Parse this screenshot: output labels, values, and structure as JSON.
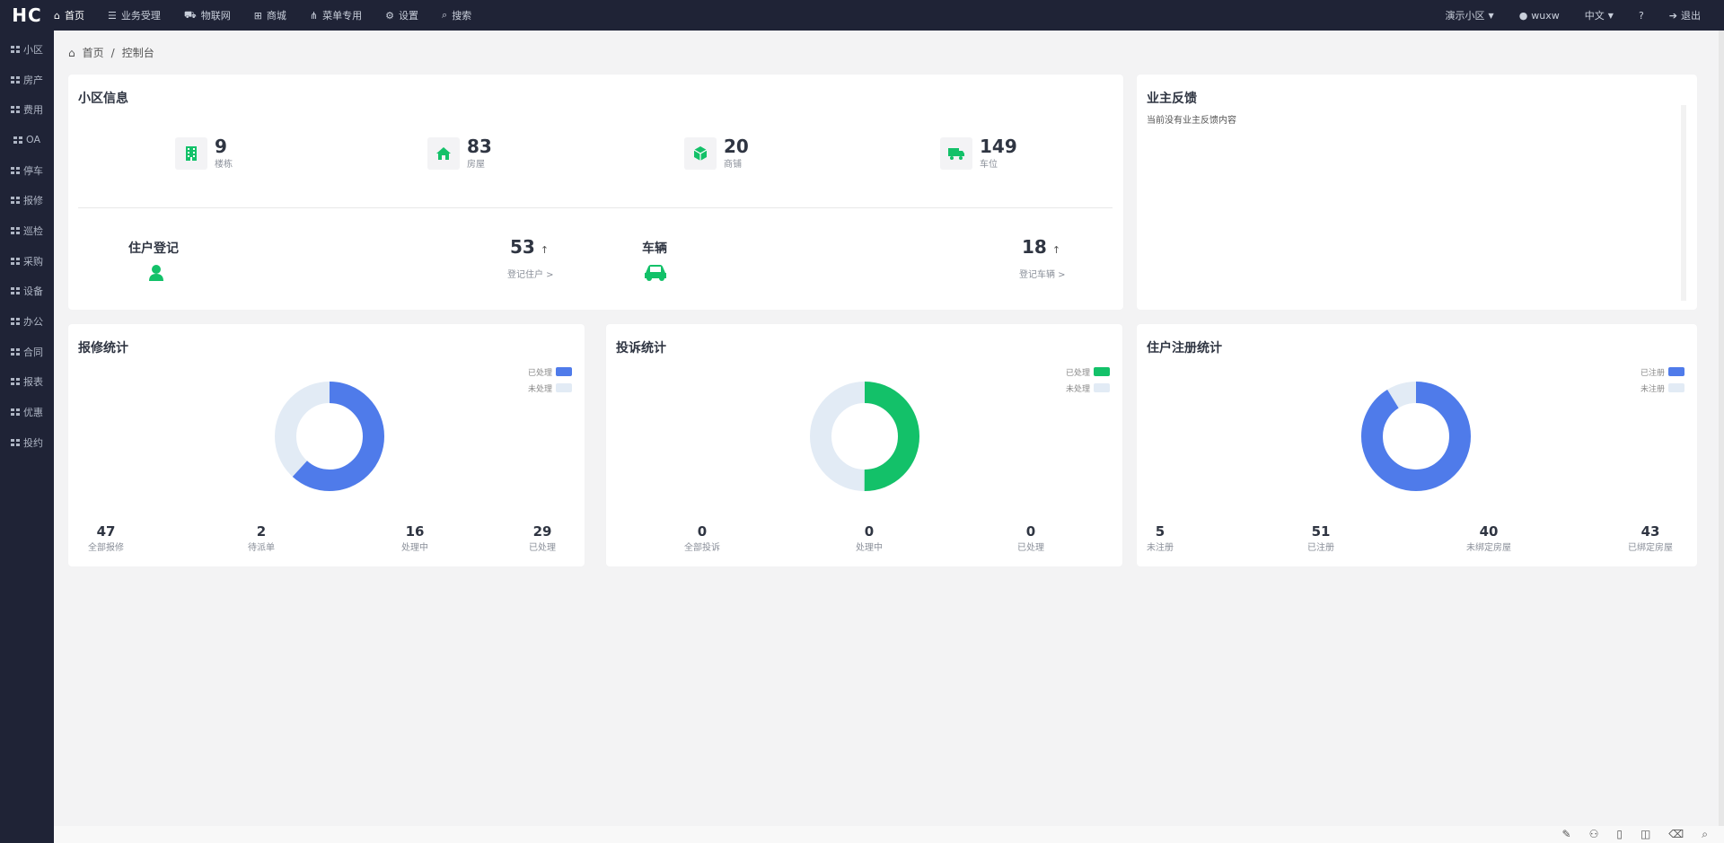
{
  "brand": "HC",
  "topnav": [
    {
      "icon": "home-icon",
      "glyph": "⌂",
      "label": "首页"
    },
    {
      "icon": "document-icon",
      "glyph": "☰",
      "label": "业务受理"
    },
    {
      "icon": "car-icon",
      "glyph": "⛟",
      "label": "物联网"
    },
    {
      "icon": "cart-icon",
      "glyph": "⊞",
      "label": "商城"
    },
    {
      "icon": "sitemap-icon",
      "glyph": "⋔",
      "label": "菜单专用"
    },
    {
      "icon": "gear-icon",
      "glyph": "⚙",
      "label": "设置"
    },
    {
      "icon": "search-icon",
      "glyph": "⌕",
      "label": "搜索"
    }
  ],
  "topright": {
    "community": "演示小区",
    "user": "wuxw",
    "language": "中文",
    "help_glyph": "?",
    "logout": "退出"
  },
  "sidebar": [
    {
      "label": "小区"
    },
    {
      "label": "房产"
    },
    {
      "label": "费用"
    },
    {
      "label": "OA"
    },
    {
      "label": "停车"
    },
    {
      "label": "报修"
    },
    {
      "label": "巡检"
    },
    {
      "label": "采购"
    },
    {
      "label": "设备"
    },
    {
      "label": "办公"
    },
    {
      "label": "合同"
    },
    {
      "label": "报表"
    },
    {
      "label": "优惠"
    },
    {
      "label": "投约"
    }
  ],
  "breadcrumb": {
    "home": "首页",
    "sep": "/",
    "current": "控制台"
  },
  "community_info": {
    "title": "小区信息",
    "stats": [
      {
        "value": "9",
        "label": "楼栋",
        "icon": "building-icon"
      },
      {
        "value": "83",
        "label": "房屋",
        "icon": "house-icon"
      },
      {
        "value": "20",
        "label": "商铺",
        "icon": "cube-icon"
      },
      {
        "value": "149",
        "label": "车位",
        "icon": "truck-icon"
      }
    ],
    "resident": {
      "title": "住户登记",
      "value": "53",
      "link": "登记住户 >"
    },
    "vehicle": {
      "title": "车辆",
      "value": "18",
      "link": "登记车辆 >"
    }
  },
  "feedback": {
    "title": "业主反馈",
    "content": "当前没有业主反馈内容"
  },
  "repair": {
    "title": "报修统计",
    "legend": [
      "已处理",
      "未处理"
    ],
    "colors": [
      "#4f7bea",
      "#e2ebf5"
    ],
    "values": {
      "processed": 29,
      "unprocessed": 18
    },
    "stats": [
      {
        "value": "47",
        "label": "全部报修"
      },
      {
        "value": "2",
        "label": "待派单"
      },
      {
        "value": "16",
        "label": "处理中"
      },
      {
        "value": "29",
        "label": "已处理"
      }
    ]
  },
  "complaint": {
    "title": "投诉统计",
    "legend": [
      "已处理",
      "未处理"
    ],
    "colors": [
      "#13c169",
      "#e2ebf5"
    ],
    "values": {
      "processed": 1,
      "unprocessed": 1
    },
    "stats": [
      {
        "value": "0",
        "label": "全部投诉"
      },
      {
        "value": "0",
        "label": "处理中"
      },
      {
        "value": "0",
        "label": "已处理"
      }
    ]
  },
  "register": {
    "title": "住户注册统计",
    "legend": [
      "已注册",
      "未注册"
    ],
    "colors": [
      "#4f7bea",
      "#e2ebf5"
    ],
    "values": {
      "registered": 51,
      "unregistered": 5
    },
    "stats": [
      {
        "value": "5",
        "label": "未注册"
      },
      {
        "value": "51",
        "label": "已注册"
      },
      {
        "value": "40",
        "label": "未绑定房屋"
      },
      {
        "value": "43",
        "label": "已绑定房屋"
      }
    ]
  },
  "status_glyphs": [
    "✎",
    "⚇",
    "▯",
    "◫",
    "⌫",
    "⌕"
  ]
}
